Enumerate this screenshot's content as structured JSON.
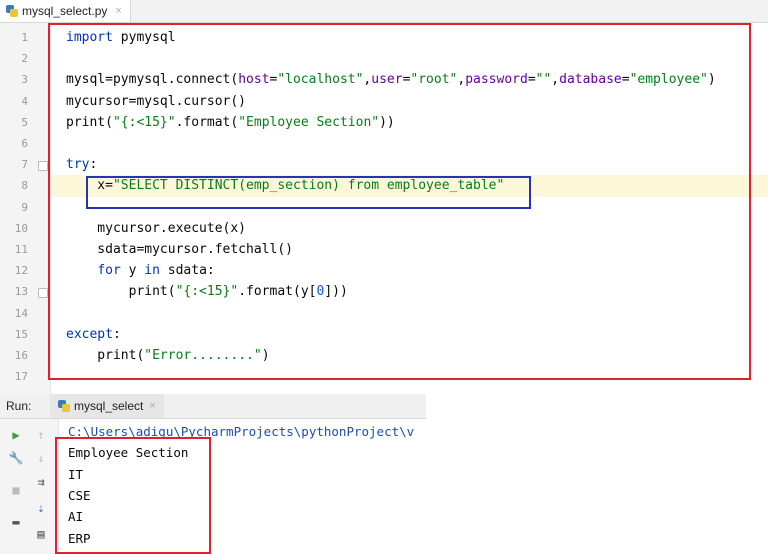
{
  "tab": {
    "filename": "mysql_select.py",
    "close": "×"
  },
  "code_lines": [
    {
      "n": "1",
      "tokens": [
        [
          "kw",
          "import"
        ],
        [
          "plain",
          " pymysql"
        ]
      ]
    },
    {
      "n": "2",
      "tokens": []
    },
    {
      "n": "3",
      "tokens": [
        [
          "plain",
          "mysql=pymysql.connect("
        ],
        [
          "param",
          "host"
        ],
        [
          "plain",
          "="
        ],
        [
          "str",
          "\"localhost\""
        ],
        [
          "plain",
          ","
        ],
        [
          "param",
          "user"
        ],
        [
          "plain",
          "="
        ],
        [
          "str",
          "\"root\""
        ],
        [
          "plain",
          ","
        ],
        [
          "param",
          "password"
        ],
        [
          "plain",
          "="
        ],
        [
          "str",
          "\"\""
        ],
        [
          "plain",
          ","
        ],
        [
          "param",
          "database"
        ],
        [
          "plain",
          "="
        ],
        [
          "str",
          "\"employee\""
        ],
        [
          "plain",
          ")"
        ]
      ]
    },
    {
      "n": "4",
      "tokens": [
        [
          "plain",
          "mycursor=mysql.cursor()"
        ]
      ]
    },
    {
      "n": "5",
      "tokens": [
        [
          "plain",
          "print("
        ],
        [
          "str",
          "\"{:<15}\""
        ],
        [
          "plain",
          ".format("
        ],
        [
          "str",
          "\"Employee Section\""
        ],
        [
          "plain",
          "))"
        ]
      ]
    },
    {
      "n": "6",
      "tokens": []
    },
    {
      "n": "7",
      "tokens": [
        [
          "kw",
          "try"
        ],
        [
          "plain",
          ":"
        ]
      ]
    },
    {
      "n": "8",
      "tokens": [
        [
          "plain",
          "    x="
        ],
        [
          "str",
          "\"SELECT DISTINCT(emp_section) from employee_table\""
        ]
      ]
    },
    {
      "n": "9",
      "tokens": []
    },
    {
      "n": "10",
      "tokens": [
        [
          "plain",
          "    mycursor.execute(x)"
        ]
      ]
    },
    {
      "n": "11",
      "tokens": [
        [
          "plain",
          "    sdata=mycursor.fetchall()"
        ]
      ]
    },
    {
      "n": "12",
      "tokens": [
        [
          "plain",
          "    "
        ],
        [
          "kw",
          "for"
        ],
        [
          "plain",
          " y "
        ],
        [
          "kw",
          "in"
        ],
        [
          "plain",
          " sdata:"
        ]
      ]
    },
    {
      "n": "13",
      "tokens": [
        [
          "plain",
          "        print("
        ],
        [
          "str",
          "\"{:<15}\""
        ],
        [
          "plain",
          ".format(y["
        ],
        [
          "num",
          "0"
        ],
        [
          "plain",
          "]))"
        ]
      ]
    },
    {
      "n": "14",
      "tokens": []
    },
    {
      "n": "15",
      "tokens": [
        [
          "kw",
          "except"
        ],
        [
          "plain",
          ":"
        ]
      ]
    },
    {
      "n": "16",
      "tokens": [
        [
          "plain",
          "    print("
        ],
        [
          "str",
          "\"Error........\""
        ],
        [
          "plain",
          ")"
        ]
      ]
    },
    {
      "n": "17",
      "tokens": []
    }
  ],
  "run": {
    "label": "Run:",
    "config_name": "mysql_select",
    "close": "×",
    "output": [
      "C:\\Users\\adigu\\PycharmProjects\\pythonProject\\v",
      "Employee Section",
      "IT",
      "CSE",
      "AI",
      "ERP"
    ]
  },
  "colors": {
    "highlight_box": "#e0202e",
    "focus_box": "#2434b8",
    "keyword": "#0033b3",
    "string": "#067d17"
  },
  "icons": [
    "python-file-icon",
    "close-icon",
    "run-icon",
    "up-arrow-icon",
    "wrench-icon",
    "down-arrow-icon",
    "stop-icon",
    "soft-wrap-icon",
    "layout-icon",
    "scroll-end-icon",
    "print-icon"
  ]
}
